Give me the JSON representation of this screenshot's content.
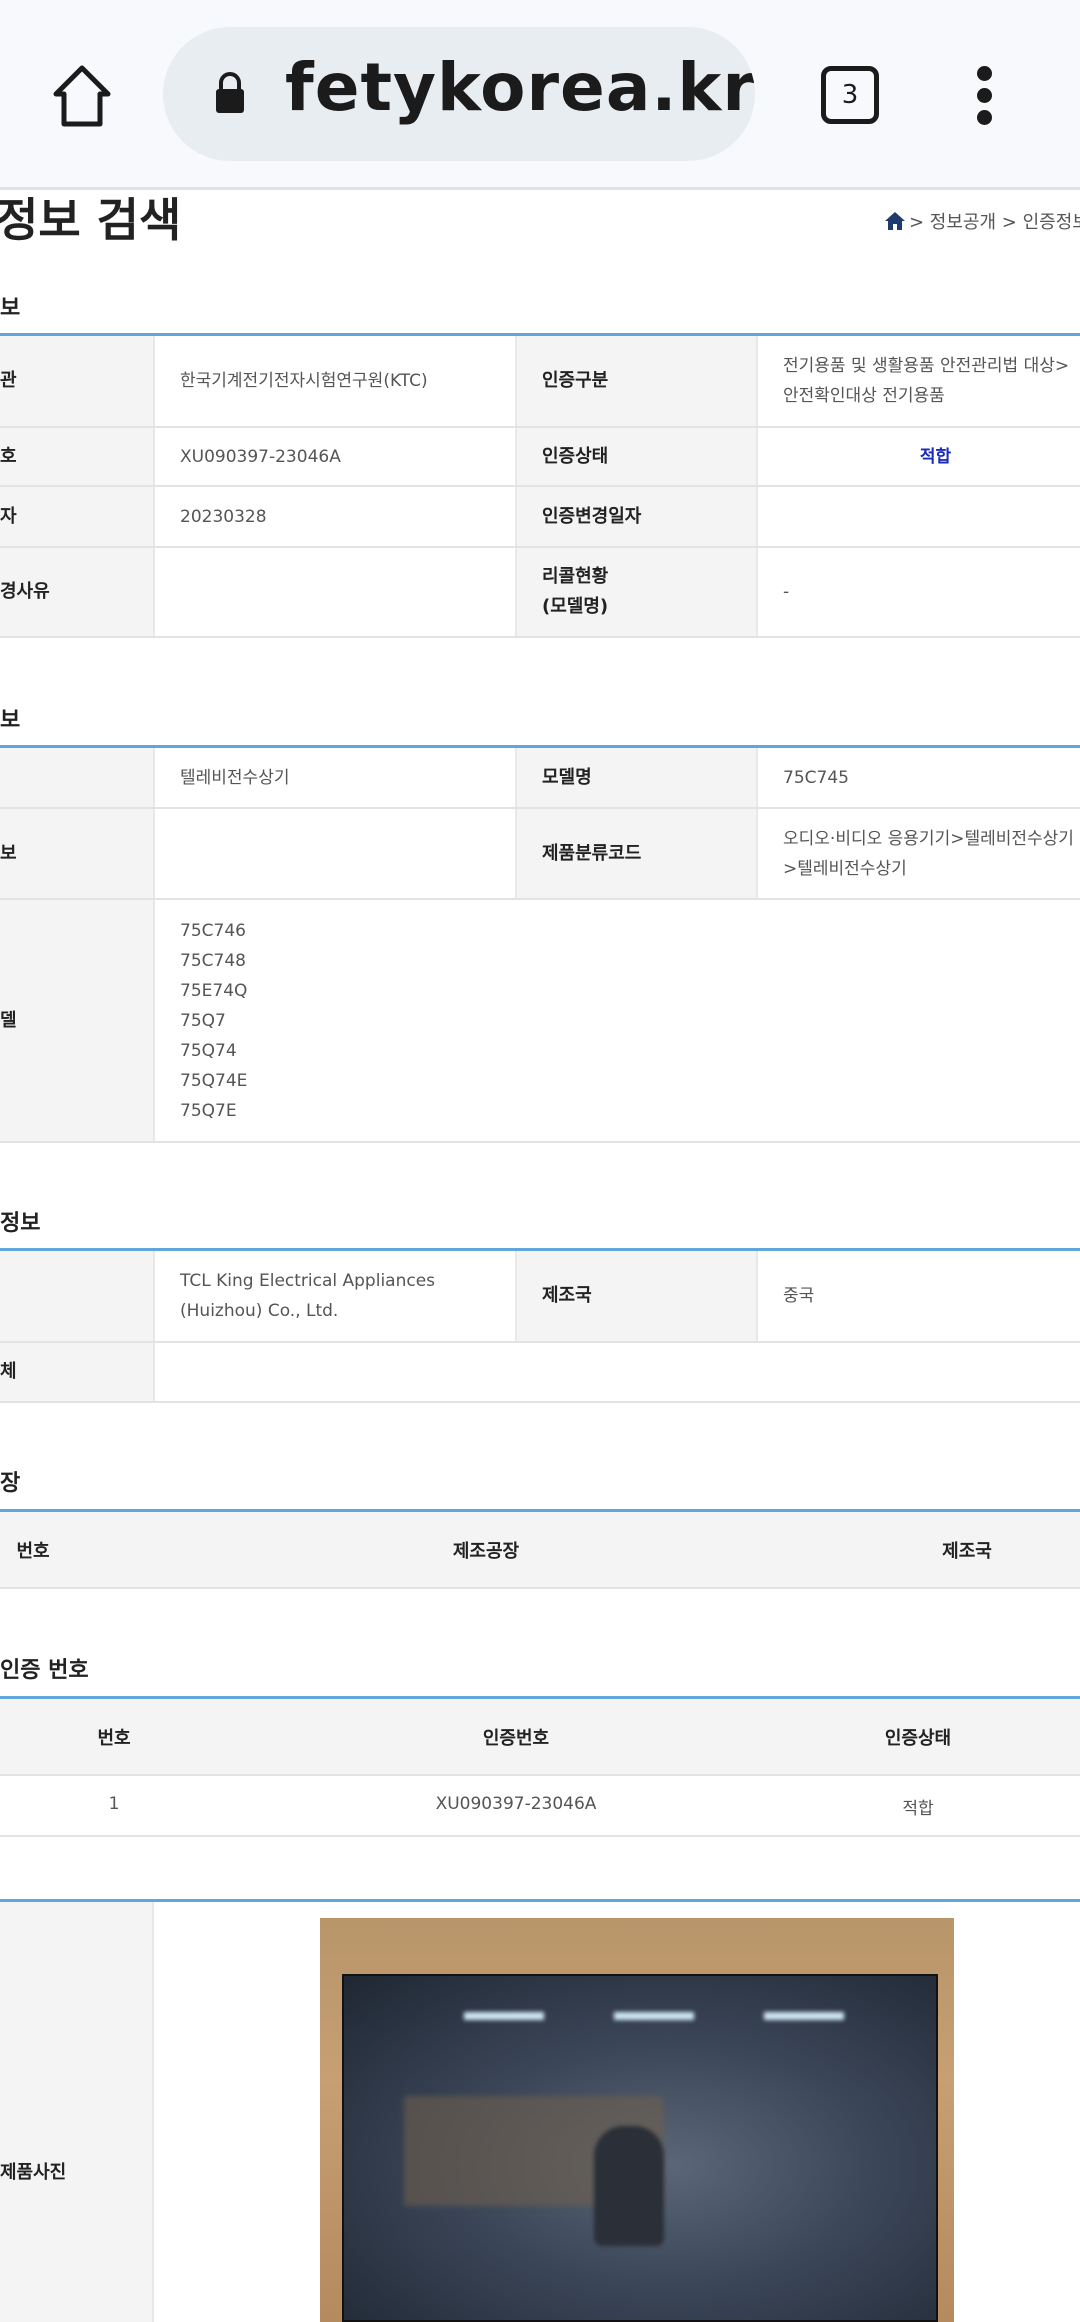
{
  "browser": {
    "url": "fetykorea.kr",
    "tab_count": "3"
  },
  "page": {
    "title": "정보 검색",
    "breadcrumb": [
      "> 정보공개 > 인증정보"
    ]
  },
  "colors": {
    "accent_line": "#5ea6dc",
    "status_blue": "#1a2bb8"
  },
  "cert_info": {
    "heading": "보",
    "rows": [
      {
        "label": "관",
        "value": "한국기계전기전자시험연구원(KTC)",
        "label2": "인증구분",
        "value2_lines": [
          "전기용품 및 생활용품 안전관리법 대상>",
          "안전확인대상 전기용품"
        ]
      },
      {
        "label": "호",
        "value": "XU090397-23046A",
        "label2": "인증상태",
        "value2": "적합"
      },
      {
        "label": "자",
        "value": "20230328",
        "label2": "인증변경일자",
        "value2": ""
      },
      {
        "label": "경사유",
        "value": "",
        "label2_lines": [
          "리콜현황",
          "(모델명)"
        ],
        "value2": "-"
      }
    ]
  },
  "product_info": {
    "heading": "보",
    "product_name": "텔레비전수상기",
    "model_label": "모델명",
    "model": "75C745",
    "row2_label": "보",
    "class_label": "제품분류코드",
    "class_lines": [
      "오디오·비디오 응용기기>텔레비전수상기",
      ">텔레비전수상기"
    ],
    "derived_label": "델",
    "derived_models": [
      "75C746",
      "75C748",
      "75E74Q",
      "75Q7",
      "75Q74",
      "75Q74E",
      "75Q7E"
    ]
  },
  "maker_info": {
    "heading": "정보",
    "maker_lines": [
      "TCL King Electrical Appliances",
      "(Huizhou) Co., Ltd."
    ],
    "country_label": "제조국",
    "country": "중국",
    "row2_label": "체"
  },
  "factory": {
    "heading": "장",
    "headers": [
      "번호",
      "제조공장",
      "제조국"
    ]
  },
  "related": {
    "heading": "인증 번호",
    "headers": [
      "번호",
      "인증번호",
      "인증상태"
    ],
    "rows": [
      [
        "1",
        "XU090397-23046A",
        "적합"
      ]
    ]
  },
  "photo": {
    "label": "제품사진"
  }
}
